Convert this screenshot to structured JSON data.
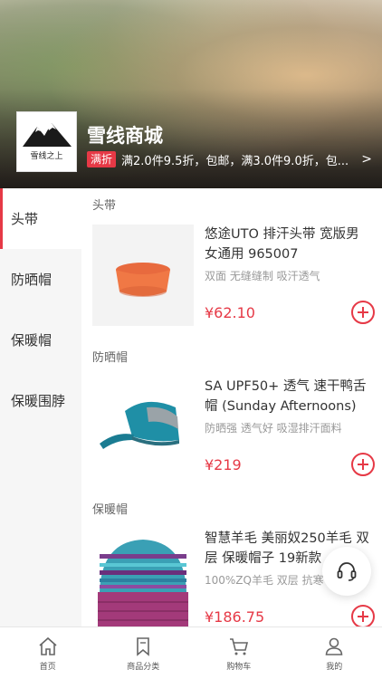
{
  "shop": {
    "name": "雪线商城",
    "logo_text": "雪线之上",
    "promo_tag": "满折",
    "promo_text": "满2.0件9.5折，包邮，满3.0件9.0折，包...",
    "promo_arrow": ">"
  },
  "sidebar": {
    "items": [
      {
        "label": "头带",
        "active": true
      },
      {
        "label": "防晒帽",
        "active": false
      },
      {
        "label": "保暖帽",
        "active": false
      },
      {
        "label": "保暖围脖",
        "active": false
      }
    ]
  },
  "sections": [
    {
      "title": "头带",
      "product": {
        "name": "悠途UTO 排汗头带 宽版男女通用 965007",
        "tags": "双面 无缝缝制 吸汗透气",
        "price": "¥62.10",
        "image_icon": "headband-image"
      }
    },
    {
      "title": "防晒帽",
      "product": {
        "name": "SA UPF50+ 透气 速干鸭舌帽 (Sunday Afternoons)",
        "tags": "防晒强 透气好 吸湿排汗面料",
        "price": "¥219",
        "image_icon": "cap-image"
      }
    },
    {
      "title": "保暖帽",
      "product": {
        "name": "智慧羊毛 美丽奴250羊毛 双层 保暖帽子 19新款",
        "tags": "100%ZQ羊毛 双层 抗寒",
        "price": "¥186.75",
        "image_icon": "beanie-image"
      }
    }
  ],
  "support": {
    "icon": "headset-icon"
  },
  "tabbar": {
    "tabs": [
      {
        "label": "首页",
        "icon": "home-icon"
      },
      {
        "label": "商品分类",
        "icon": "bookmark-icon"
      },
      {
        "label": "购物车",
        "icon": "cart-icon"
      },
      {
        "label": "我的",
        "icon": "user-icon"
      }
    ]
  },
  "colors": {
    "accent": "#e63946",
    "sidebar_bg": "#f6f6f6"
  }
}
